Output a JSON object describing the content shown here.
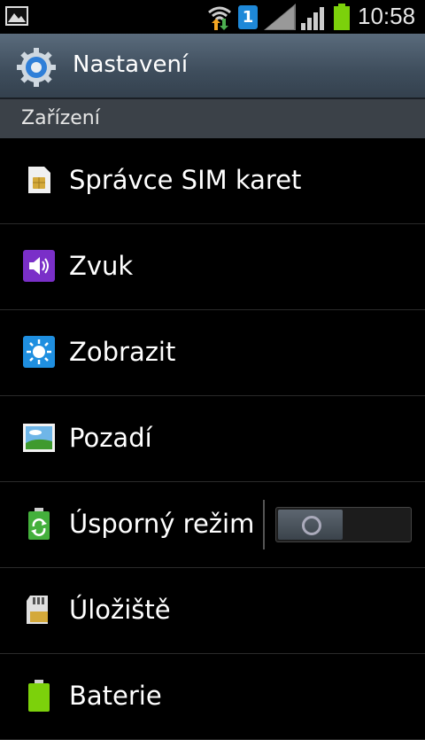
{
  "status_bar": {
    "time": "10:58",
    "sim_slot": "1",
    "battery_color": "#7cd10b"
  },
  "title_bar": {
    "title": "Nastavení",
    "icon": "gear-icon"
  },
  "section": {
    "label": "Zařízení"
  },
  "items": [
    {
      "label": "Správce SIM karet",
      "icon": "sim-card-icon"
    },
    {
      "label": "Zvuk",
      "icon": "speaker-icon"
    },
    {
      "label": "Zobrazit",
      "icon": "brightness-icon"
    },
    {
      "label": "Pozadí",
      "icon": "wallpaper-icon"
    },
    {
      "label": "Úsporný režim",
      "icon": "battery-recycle-icon",
      "toggle": false
    },
    {
      "label": "Úložiště",
      "icon": "sd-card-icon"
    },
    {
      "label": "Baterie",
      "icon": "battery-icon"
    }
  ]
}
